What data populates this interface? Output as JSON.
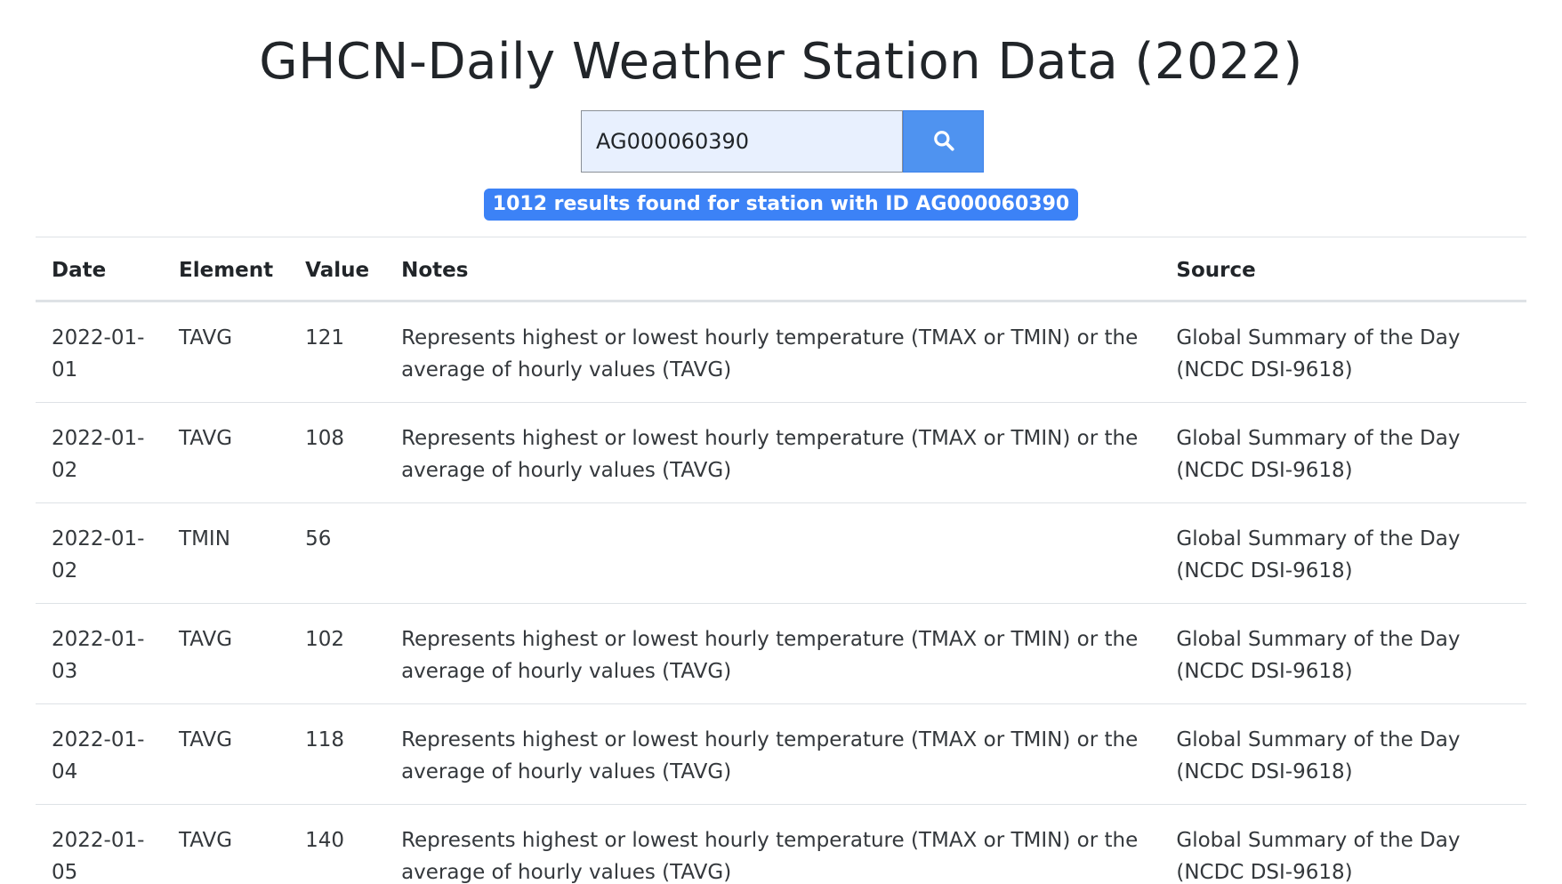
{
  "page": {
    "title": "GHCN-Daily Weather Station Data (2022)"
  },
  "search": {
    "value": "AG000060390",
    "button_icon": "search-icon"
  },
  "results": {
    "badge_text": "1012 results found for station with ID AG000060390"
  },
  "table": {
    "headers": {
      "date": "Date",
      "element": "Element",
      "value": "Value",
      "notes": "Notes",
      "source": "Source"
    },
    "rows": [
      {
        "date": "2022-01-01",
        "element": "TAVG",
        "value": "121",
        "notes": "Represents highest or lowest hourly temperature (TMAX or TMIN) or the average of hourly values (TAVG)",
        "source": "Global Summary of the Day (NCDC DSI-9618)"
      },
      {
        "date": "2022-01-02",
        "element": "TAVG",
        "value": "108",
        "notes": "Represents highest or lowest hourly temperature (TMAX or TMIN) or the average of hourly values (TAVG)",
        "source": "Global Summary of the Day (NCDC DSI-9618)"
      },
      {
        "date": "2022-01-02",
        "element": "TMIN",
        "value": "56",
        "notes": "",
        "source": "Global Summary of the Day (NCDC DSI-9618)"
      },
      {
        "date": "2022-01-03",
        "element": "TAVG",
        "value": "102",
        "notes": "Represents highest or lowest hourly temperature (TMAX or TMIN) or the average of hourly values (TAVG)",
        "source": "Global Summary of the Day (NCDC DSI-9618)"
      },
      {
        "date": "2022-01-04",
        "element": "TAVG",
        "value": "118",
        "notes": "Represents highest or lowest hourly temperature (TMAX or TMIN) or the average of hourly values (TAVG)",
        "source": "Global Summary of the Day (NCDC DSI-9618)"
      },
      {
        "date": "2022-01-05",
        "element": "TAVG",
        "value": "140",
        "notes": "Represents highest or lowest hourly temperature (TMAX or TMIN) or the average of hourly values (TAVG)",
        "source": "Global Summary of the Day (NCDC DSI-9618)"
      }
    ]
  },
  "colors": {
    "accent": "#4f93f0",
    "badge": "#3c82f6",
    "input_bg": "#e8f0fe"
  }
}
